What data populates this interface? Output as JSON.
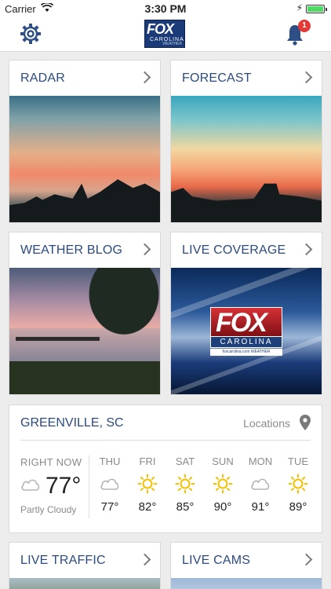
{
  "status_bar": {
    "carrier": "Carrier",
    "time": "3:30 PM"
  },
  "nav": {
    "logo_text": "FOX",
    "logo_sub": "CAROLINA",
    "logo_weather": "WEATHER",
    "notification_count": "1"
  },
  "tiles": [
    {
      "label": "RADAR"
    },
    {
      "label": "FORECAST"
    },
    {
      "label": "WEATHER BLOG"
    },
    {
      "label": "LIVE COVERAGE"
    },
    {
      "label": "LIVE TRAFFIC"
    },
    {
      "label": "LIVE CAMS"
    }
  ],
  "live_logo": {
    "word": "FOX",
    "sub": "CAROLINA",
    "site": "foxcarolina.com   WEATHER"
  },
  "weather": {
    "city": "GREENVILLE, SC",
    "locations_label": "Locations",
    "right_now_label": "RIGHT NOW",
    "current_temp": "77°",
    "condition": "Partly Cloudy",
    "current_icon": "cloud-icon",
    "days": [
      {
        "name": "THU",
        "temp": "77°",
        "icon": "cloud-icon"
      },
      {
        "name": "FRI",
        "temp": "82°",
        "icon": "sun-icon"
      },
      {
        "name": "SAT",
        "temp": "85°",
        "icon": "sun-icon"
      },
      {
        "name": "SUN",
        "temp": "90°",
        "icon": "sun-icon"
      },
      {
        "name": "MON",
        "temp": "91°",
        "icon": "cloud-icon"
      },
      {
        "name": "TUE",
        "temp": "89°",
        "icon": "sun-icon"
      }
    ]
  },
  "colors": {
    "accent": "#2b4a7e",
    "badge": "#e53935",
    "sun": "#f2c100"
  }
}
